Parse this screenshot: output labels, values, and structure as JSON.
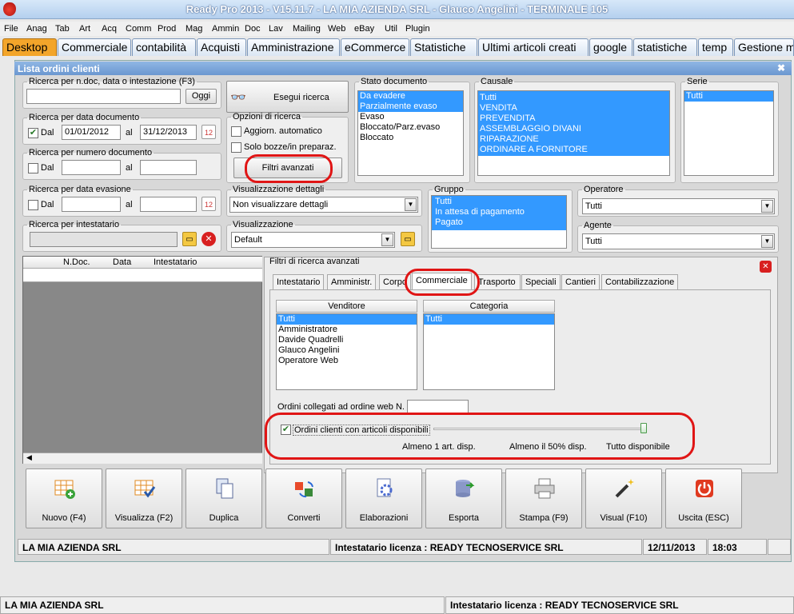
{
  "window": {
    "title": "Ready Pro 2013 - V15.11.7 - LA MIA AZIENDA SRL - Glauco Angelini - TERMINALE 105"
  },
  "menu": [
    "File",
    "Anag",
    "Tab",
    "Art",
    "Acq",
    "Comm",
    "Prod",
    "Mag",
    "Ammin",
    "Doc",
    "Lav",
    "Mailing",
    "Web",
    "eBay",
    "Util",
    "Plugin"
  ],
  "tabs": [
    "Desktop",
    "Commerciale",
    "contabilità",
    "Acquisti",
    "Amministrazione",
    "eCommerce",
    "Statistiche",
    "Ultimi articoli creati",
    "google",
    "statistiche",
    "temp",
    "Gestione m"
  ],
  "panel": {
    "title": "Lista ordini clienti"
  },
  "search_ndoc": {
    "legend": "Ricerca per n.doc, data o intestazione (F3)",
    "value": "",
    "button": "Oggi"
  },
  "execute_button": "Esegui ricerca",
  "search_date": {
    "legend": "Ricerca per data documento",
    "dal": "Dal",
    "al": "al",
    "from": "01/01/2012",
    "to": "31/12/2013",
    "checked": true
  },
  "search_number": {
    "legend": "Ricerca per numero documento",
    "dal": "Dal",
    "al": "al"
  },
  "search_evasion": {
    "legend": "Ricerca per data evasione",
    "dal": "Dal",
    "al": "al"
  },
  "search_holder": {
    "legend": "Ricerca per intestatario"
  },
  "options": {
    "legend": "Opzioni di ricerca",
    "auto": "Aggiorn. automatico",
    "drafts": "Solo bozze/in preparaz.",
    "advanced_button": "Filtri avanzati"
  },
  "doc_status": {
    "legend": "Stato documento",
    "items": [
      "Da evadere",
      "Parzialmente evaso",
      "Evaso",
      "Bloccato/Parz.evaso",
      "Bloccato"
    ],
    "selected": [
      0,
      1
    ]
  },
  "causale": {
    "legend": "Causale",
    "items": [
      "Tutti",
      "VENDITA",
      "PREVENDITA",
      "ASSEMBLAGGIO DIVANI",
      "RIPARAZIONE",
      "ORDINARE A FORNITORE"
    ]
  },
  "serie": {
    "legend": "Serie",
    "items": [
      "Tutti"
    ]
  },
  "details_view": {
    "legend": "Visualizzazione dettagli",
    "value": "Non visualizzare dettagli"
  },
  "view": {
    "legend": "Visualizzazione",
    "value": "Default"
  },
  "gruppo": {
    "legend": "Gruppo",
    "items": [
      "Tutti",
      "In attesa di pagamento",
      "Pagato"
    ]
  },
  "operatore": {
    "legend": "Operatore",
    "value": "Tutti"
  },
  "agente": {
    "legend": "Agente",
    "value": "Tutti"
  },
  "grid": {
    "columns": [
      "N.Doc.",
      "Data",
      "Intestatario"
    ]
  },
  "advanced": {
    "legend": "Filtri di ricerca avanzati",
    "tabs": [
      "Intestatario",
      "Amministr.",
      "Corpo",
      "Commerciale",
      "Trasporto",
      "Speciali",
      "Cantieri",
      "Contabilizzazione"
    ],
    "venditore": {
      "header": "Venditore",
      "items": [
        "Tutti",
        "Amministratore",
        "Davide Quadrelli",
        "Glauco Angelini",
        "Operatore Web"
      ]
    },
    "categoria": {
      "header": "Categoria",
      "items": [
        "Tutti"
      ]
    },
    "web_order_label": "Ordini collegati ad ordine web N.",
    "available_label": "Ordini clienti con articoli disponibili",
    "available_checked": true,
    "scale": [
      "Almeno 1 art. disp.",
      "Almeno il 50% disp.",
      "Tutto disponibile"
    ]
  },
  "toolbar": [
    "Nuovo (F4)",
    "Visualizza (F2)",
    "Duplica",
    "Converti",
    "Elaborazioni",
    "Esporta",
    "Stampa (F9)",
    "Visual (F10)",
    "Uscita (ESC)"
  ],
  "status_inner": {
    "company": "LA MIA AZIENDA SRL",
    "license": "Intestatario licenza : READY TECNOSERVICE SRL",
    "date": "12/11/2013",
    "time": "18:03"
  },
  "status_outer": {
    "company": "LA MIA AZIENDA SRL",
    "license": "Intestatario licenza : READY TECNOSERVICE SRL"
  }
}
